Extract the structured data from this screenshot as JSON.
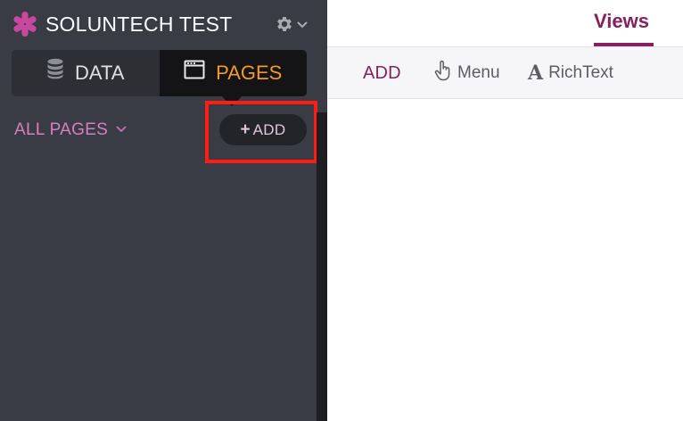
{
  "app": {
    "title": "SOLUNTECH TEST",
    "logo_icon": "asterisk-logo-icon",
    "settings_icon": "gear-icon"
  },
  "mode_toggle": {
    "data_label": "DATA",
    "data_icon": "database-icon",
    "pages_label": "PAGES",
    "pages_icon": "window-icon",
    "active": "pages"
  },
  "pages_panel": {
    "filter_label": "ALL PAGES",
    "add_button_label": "ADD",
    "add_button_prefix": "+"
  },
  "main": {
    "tabs": [
      {
        "label": "Views",
        "active": true
      }
    ],
    "toolbar": {
      "add_label": "ADD",
      "items": [
        {
          "label": "Menu",
          "icon": "pointer-hand-icon"
        },
        {
          "label": "RichText",
          "icon": "richtext-icon",
          "glyph": "A"
        }
      ]
    }
  },
  "colors": {
    "sidebar_bg": "#393b45",
    "accent_purple": "#86205f",
    "accent_orange": "#f39a1f",
    "accent_pink": "#d77fbf",
    "highlight_red": "#ff1c12"
  }
}
